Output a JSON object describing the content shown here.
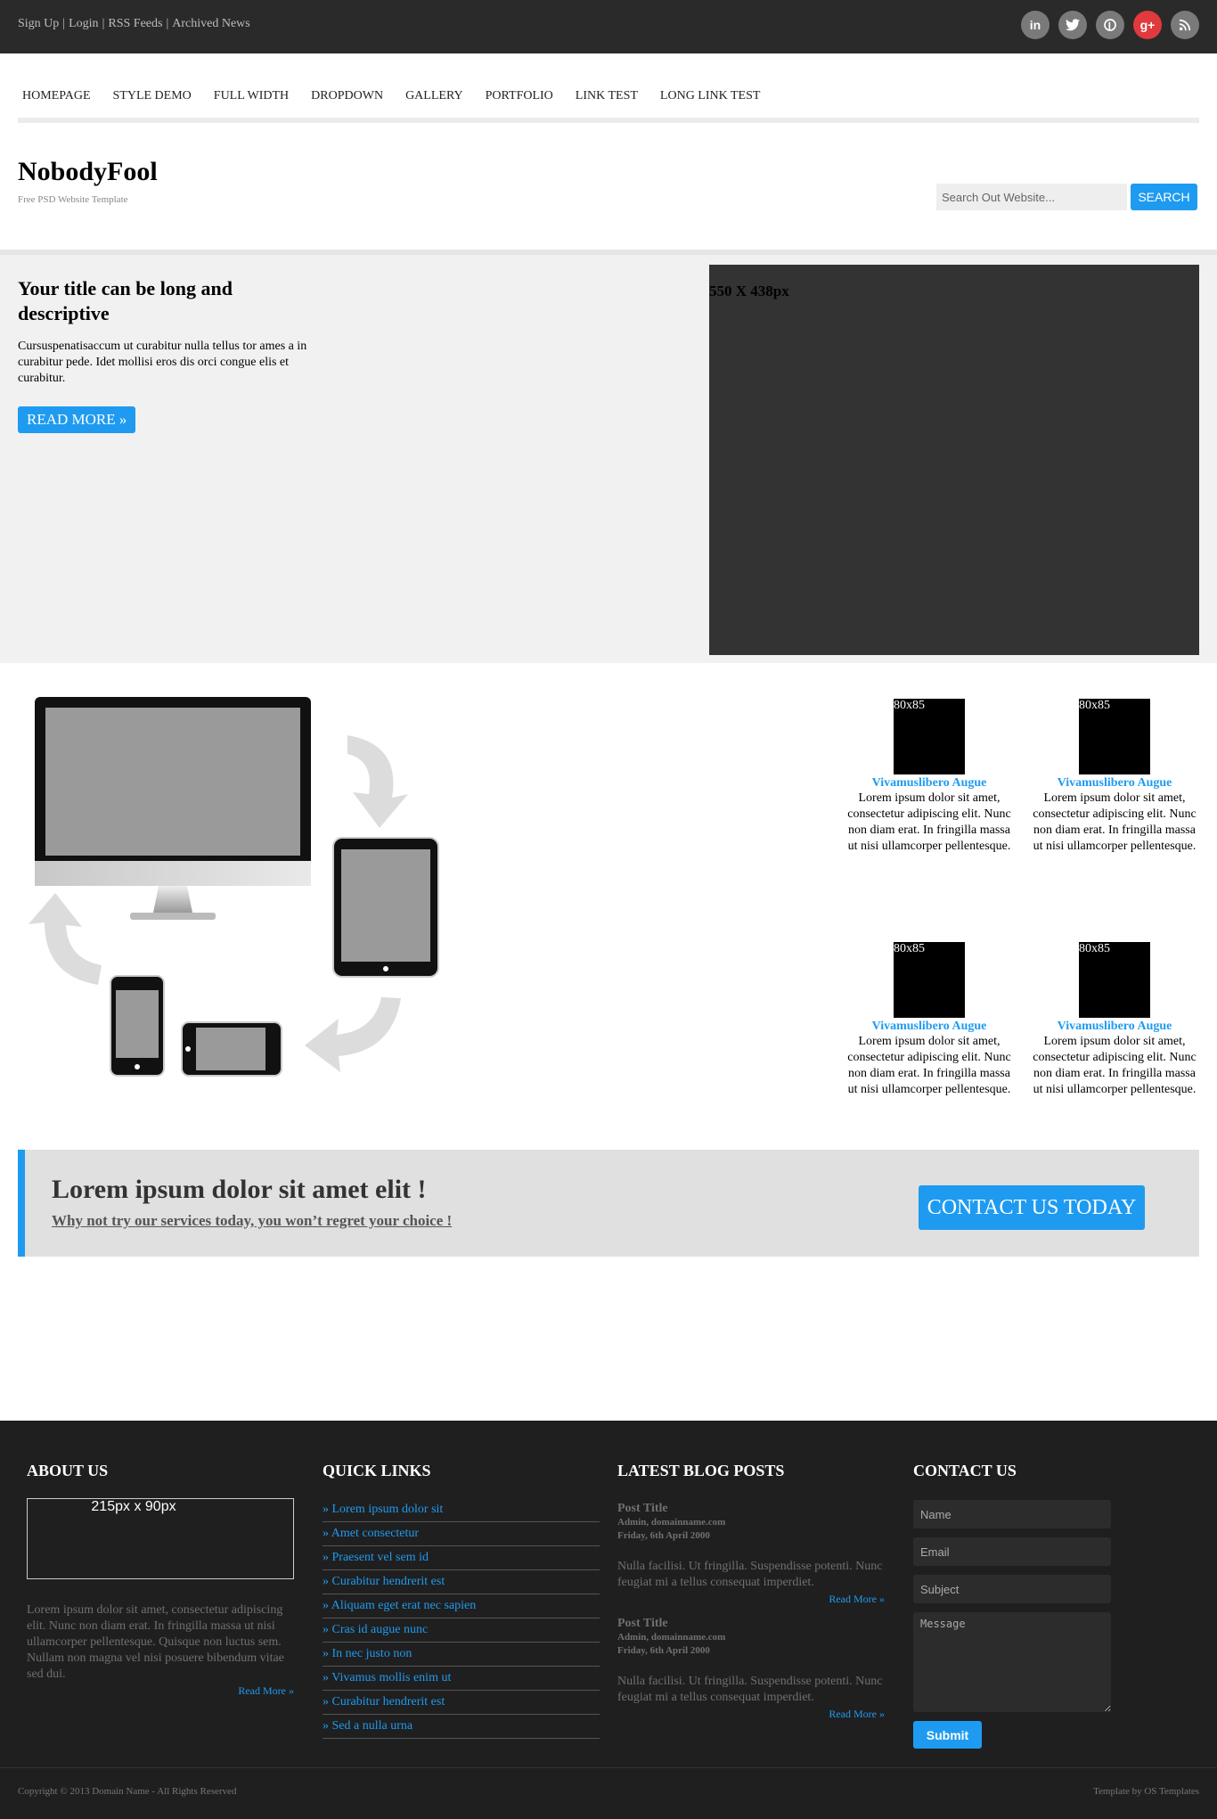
{
  "topbar": {
    "links": [
      "Sign Up",
      "Login",
      "RSS Feeds",
      "Archived News"
    ],
    "social": [
      {
        "icon": "linkedin-icon",
        "glyph": "in"
      },
      {
        "icon": "twitter-icon",
        "glyph": "t"
      },
      {
        "icon": "pinterest-icon",
        "glyph": "p"
      },
      {
        "icon": "google-plus-icon",
        "glyph": "g+"
      },
      {
        "icon": "rss-icon",
        "glyph": "◎"
      }
    ]
  },
  "nav": {
    "items": [
      "HOMEPAGE",
      "STYLE DEMO",
      "FULL WIDTH",
      "DROPDOWN",
      "GALLERY",
      "PORTFOLIO",
      "LINK TEST",
      "LONG LINK TEST"
    ]
  },
  "header": {
    "logo": "NobodyFool",
    "tagline": "Free PSD Website Template",
    "search_placeholder": "Search Out Website...",
    "search_button": "SEARCH"
  },
  "hero": {
    "title": "Your title can be long and descriptive",
    "text": "Cursuspenatisaccum ut curabitur nulla tellus tor ames a in curabitur pede. Idet mollisi eros dis orci congue elis et curabitur.",
    "read_more": "READ MORE »",
    "image_label": "550 X 438px"
  },
  "features": [
    {
      "thumb": "80x85",
      "title": "Vivamuslibero Augue",
      "body": "Lorem ipsum dolor sit amet, consectetur adipiscing elit. Nunc non diam erat. In fringilla massa ut nisi ullamcorper pellentesque."
    },
    {
      "thumb": "80x85",
      "title": "Vivamuslibero Augue",
      "body": "Lorem ipsum dolor sit amet, consectetur adipiscing elit. Nunc non diam erat. In fringilla massa ut nisi ullamcorper pellentesque."
    },
    {
      "thumb": "80x85",
      "title": "Vivamuslibero Augue",
      "body": "Lorem ipsum dolor sit amet, consectetur adipiscing elit. Nunc non diam erat. In fringilla massa ut nisi ullamcorper pellentesque."
    },
    {
      "thumb": "80x85",
      "title": "Vivamuslibero Augue",
      "body": "Lorem ipsum dolor sit amet, consectetur adipiscing elit. Nunc non diam erat. In fringilla massa ut nisi ullamcorper pellentesque."
    }
  ],
  "cta": {
    "title": "Lorem ipsum dolor sit amet elit !",
    "subtitle": "Why not try our services today, you won’t regret your choice !",
    "button": "CONTACT US TODAY"
  },
  "footer": {
    "about": {
      "heading": "ABOUT US",
      "image_label": "215px x 90px",
      "text": "Lorem ipsum dolor sit amet, consectetur adipiscing elit. Nunc non diam erat. In fringilla massa ut nisi ullamcorper pellentesque. Quisque non luctus sem. Nullam non magna vel nisi posuere bibendum vitae sed dui.",
      "read_more": "Read More »"
    },
    "quick_links": {
      "heading": "QUICK LINKS",
      "items": [
        "» Lorem ipsum dolor sit",
        "» Amet consectetur",
        "» Praesent vel sem id",
        "» Curabitur hendrerit est",
        "» Aliquam eget erat nec sapien",
        "» Cras id augue nunc",
        "» In nec justo non",
        "» Vivamus mollis enim ut",
        "» Curabitur hendrerit est",
        "» Sed a nulla urna"
      ]
    },
    "blog": {
      "heading": "LATEST BLOG POSTS",
      "posts": [
        {
          "title": "Post Title",
          "author": "Admin, domainname.com",
          "date": "Friday, 6th April 2000",
          "body": "Nulla facilisi. Ut fringilla. Suspendisse potenti. Nunc feugiat mi a tellus consequat imperdiet.",
          "read_more": "Read More »"
        },
        {
          "title": "Post Title",
          "author": "Admin, domainname.com",
          "date": "Friday, 6th April 2000",
          "body": "Nulla facilisi. Ut fringilla. Suspendisse potenti. Nunc feugiat mi a tellus consequat imperdiet.",
          "read_more": "Read More »"
        }
      ]
    },
    "contact": {
      "heading": "CONTACT US",
      "name_placeholder": "Name",
      "email_placeholder": "Email",
      "subject_placeholder": "Subject",
      "message_placeholder": "Message",
      "submit": "Submit"
    }
  },
  "bottombar": {
    "copyright": "Copyright © 2013 Domain Name - All Rights Reserved",
    "credit": "Template by OS Templates"
  },
  "colors": {
    "accent": "#1e9bf0",
    "topbar_bg": "#2a2a2a",
    "footer_bg": "#1f1f1f",
    "google_plus": "#e03a3e"
  }
}
